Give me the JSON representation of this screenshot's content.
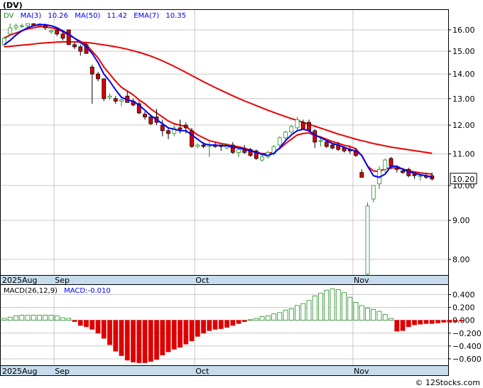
{
  "title": "(DV)",
  "watermark": "© 12Stocks.com",
  "last_price_label": "10.20",
  "legend": {
    "ticker": "DV",
    "ma3_label": "MA(3)",
    "ma3_value": "10.26",
    "ma50_label": "MA(50)",
    "ma50_value": "11.42",
    "ema7_label": "EMA(7)",
    "ema7_value": "10.35"
  },
  "macd_legend": {
    "params": "MACD(26,12,9)",
    "value": "MACD:-0.010"
  },
  "x_axis": {
    "labels": [
      "2025Aug",
      "Sep",
      "Oct",
      "Nov"
    ]
  },
  "colors": {
    "up_candle": "#228b22",
    "down_candle": "#dd0000",
    "ma3": "#0000ee",
    "ma50": "#ee0000",
    "ema7": "#ee0000",
    "axis_band": "#c6dcec",
    "grid": "#c8c8c8"
  },
  "chart_data": [
    {
      "type": "candlestick",
      "title": "",
      "y_ticks": [
        8.0,
        9.0,
        10.0,
        11.0,
        12.0,
        13.0,
        14.0,
        15.0,
        16.0
      ],
      "y_tick_labels": [
        "8.00",
        "9.00",
        "10.00",
        "11.00",
        "12.00",
        "13.00",
        "14.00",
        "15.00",
        "16.00"
      ],
      "log_scale": true,
      "grid": true,
      "ohlc": [
        [
          15.3,
          15.7,
          15.2,
          15.6
        ],
        [
          15.8,
          16.3,
          15.7,
          16.1
        ],
        [
          16.1,
          16.3,
          16.0,
          16.2
        ],
        [
          16.2,
          16.3,
          16.1,
          16.2
        ],
        [
          16.2,
          16.3,
          16.1,
          16.3
        ],
        [
          16.3,
          16.3,
          16.2,
          16.2
        ],
        [
          16.2,
          16.3,
          16.1,
          16.3
        ],
        [
          16.2,
          16.3,
          16.0,
          16.1
        ],
        [
          15.9,
          16.0,
          15.8,
          15.95
        ],
        [
          16.0,
          16.1,
          15.7,
          15.8
        ],
        [
          15.8,
          15.9,
          15.5,
          15.6
        ],
        [
          16.0,
          16.0,
          15.3,
          15.3
        ],
        [
          15.3,
          15.4,
          15.1,
          15.2
        ],
        [
          15.2,
          15.3,
          14.8,
          15.0
        ],
        [
          15.3,
          15.4,
          14.9,
          14.9
        ],
        [
          14.3,
          14.4,
          12.8,
          14.0
        ],
        [
          14.0,
          14.1,
          13.7,
          13.8
        ],
        [
          13.8,
          13.8,
          12.9,
          13.0
        ],
        [
          13.05,
          13.2,
          12.95,
          13.1
        ],
        [
          13.0,
          13.1,
          12.8,
          12.9
        ],
        [
          12.9,
          13.0,
          12.7,
          12.95
        ],
        [
          13.1,
          13.3,
          12.9,
          12.85
        ],
        [
          12.9,
          13.0,
          12.7,
          12.75
        ],
        [
          12.8,
          12.9,
          12.4,
          12.45
        ],
        [
          12.4,
          12.5,
          12.2,
          12.3
        ],
        [
          12.3,
          12.4,
          12.0,
          12.05
        ],
        [
          12.3,
          12.6,
          12.0,
          12.1
        ],
        [
          12.0,
          12.2,
          11.6,
          11.8
        ],
        [
          11.8,
          11.9,
          11.5,
          11.7
        ],
        [
          11.7,
          12.0,
          11.6,
          11.9
        ],
        [
          11.9,
          12.2,
          11.7,
          11.85
        ],
        [
          12.0,
          12.1,
          11.7,
          11.9
        ],
        [
          11.8,
          11.9,
          11.2,
          11.25
        ],
        [
          11.25,
          11.35,
          11.2,
          11.3
        ],
        [
          11.3,
          11.4,
          11.2,
          11.25
        ],
        [
          11.25,
          11.4,
          10.9,
          11.3
        ],
        [
          11.3,
          11.4,
          11.2,
          11.25
        ],
        [
          11.3,
          11.3,
          11.1,
          11.25
        ],
        [
          11.2,
          11.35,
          11.15,
          11.3
        ],
        [
          11.3,
          11.4,
          11.0,
          11.05
        ],
        [
          11.05,
          11.2,
          10.9,
          11.15
        ],
        [
          11.15,
          11.3,
          11.0,
          11.05
        ],
        [
          11.15,
          11.2,
          10.9,
          10.95
        ],
        [
          11.1,
          11.15,
          10.8,
          10.85
        ],
        [
          10.8,
          10.95,
          10.75,
          10.9
        ],
        [
          10.9,
          11.1,
          10.85,
          11.05
        ],
        [
          11.0,
          11.3,
          10.95,
          11.25
        ],
        [
          11.3,
          11.6,
          11.2,
          11.55
        ],
        [
          11.55,
          11.8,
          11.45,
          11.75
        ],
        [
          11.75,
          12.0,
          11.7,
          11.95
        ],
        [
          11.9,
          12.3,
          11.8,
          12.2
        ],
        [
          12.1,
          12.2,
          11.9,
          11.85
        ],
        [
          12.1,
          12.2,
          11.75,
          11.8
        ],
        [
          11.8,
          11.85,
          11.2,
          11.4
        ],
        [
          11.45,
          11.55,
          11.25,
          11.45
        ],
        [
          11.4,
          11.45,
          11.2,
          11.25
        ],
        [
          11.3,
          11.35,
          11.15,
          11.2
        ],
        [
          11.3,
          11.4,
          11.1,
          11.15
        ],
        [
          11.2,
          11.25,
          11.05,
          11.1
        ],
        [
          11.15,
          11.25,
          11.0,
          11.1
        ],
        [
          11.1,
          11.2,
          10.9,
          10.95
        ],
        [
          10.4,
          10.5,
          10.3,
          10.25
        ],
        [
          7.65,
          9.5,
          7.55,
          9.4
        ],
        [
          9.6,
          10.0,
          9.5,
          10.0
        ],
        [
          10.05,
          10.6,
          9.9,
          10.5
        ],
        [
          10.5,
          10.85,
          10.4,
          10.8
        ],
        [
          10.85,
          10.9,
          10.5,
          10.6
        ],
        [
          10.55,
          10.6,
          10.4,
          10.5
        ],
        [
          10.45,
          10.55,
          10.35,
          10.4
        ],
        [
          10.5,
          10.55,
          10.25,
          10.3
        ],
        [
          10.35,
          10.4,
          10.2,
          10.3
        ],
        [
          10.3,
          10.4,
          10.15,
          10.3
        ],
        [
          10.3,
          10.35,
          10.2,
          10.25
        ],
        [
          10.3,
          10.4,
          10.15,
          10.2
        ]
      ],
      "series": [
        {
          "name": "MA(3)",
          "values": [
            15.3,
            15.5,
            15.75,
            15.95,
            16.1,
            16.2,
            16.25,
            16.25,
            16.2,
            16.1,
            15.95,
            15.8,
            15.6,
            15.4,
            15.2,
            14.9,
            14.5,
            14.0,
            13.7,
            13.35,
            13.05,
            12.95,
            12.9,
            12.75,
            12.55,
            12.35,
            12.2,
            12.05,
            11.9,
            11.85,
            11.8,
            11.8,
            11.65,
            11.5,
            11.35,
            11.3,
            11.3,
            11.28,
            11.27,
            11.23,
            11.2,
            11.15,
            11.1,
            11.05,
            10.98,
            10.95,
            11.02,
            11.2,
            11.45,
            11.65,
            11.8,
            11.85,
            11.8,
            11.65,
            11.55,
            11.45,
            11.35,
            11.3,
            11.22,
            11.15,
            11.1,
            10.95,
            10.6,
            10.3,
            10.25,
            10.35,
            10.6,
            10.6,
            10.5,
            10.42,
            10.38,
            10.33,
            10.3,
            10.26
          ]
        },
        {
          "name": "MA(50)",
          "values": [
            15.2,
            15.22,
            15.25,
            15.28,
            15.3,
            15.33,
            15.36,
            15.38,
            15.4,
            15.42,
            15.43,
            15.43,
            15.43,
            15.42,
            15.4,
            15.37,
            15.33,
            15.29,
            15.25,
            15.2,
            15.15,
            15.09,
            15.02,
            14.95,
            14.87,
            14.78,
            14.68,
            14.57,
            14.45,
            14.33,
            14.2,
            14.07,
            13.94,
            13.81,
            13.68,
            13.56,
            13.44,
            13.33,
            13.22,
            13.11,
            13.01,
            12.91,
            12.82,
            12.73,
            12.64,
            12.55,
            12.47,
            12.39,
            12.31,
            12.24,
            12.17,
            12.1,
            12.03,
            11.96,
            11.89,
            11.82,
            11.75,
            11.68,
            11.62,
            11.56,
            11.5,
            11.45,
            11.4,
            11.35,
            11.31,
            11.27,
            11.23,
            11.2,
            11.17,
            11.14,
            11.11,
            11.08,
            11.05,
            11.02
          ]
        },
        {
          "name": "EMA(7)",
          "values": [
            15.6,
            15.75,
            15.85,
            15.95,
            16.05,
            16.1,
            16.15,
            16.15,
            16.1,
            16.05,
            15.9,
            15.75,
            15.6,
            15.45,
            15.3,
            15.0,
            14.7,
            14.3,
            14.0,
            13.7,
            13.45,
            13.3,
            13.15,
            12.95,
            12.8,
            12.6,
            12.45,
            12.3,
            12.15,
            12.05,
            12.0,
            11.95,
            11.8,
            11.65,
            11.55,
            11.45,
            11.4,
            11.35,
            11.32,
            11.27,
            11.24,
            11.19,
            11.13,
            11.06,
            11.01,
            11.01,
            11.06,
            11.18,
            11.35,
            11.5,
            11.65,
            11.7,
            11.72,
            11.63,
            11.58,
            11.5,
            11.42,
            11.36,
            11.29,
            11.25,
            11.17,
            10.95,
            10.6,
            10.45,
            10.43,
            10.52,
            10.55,
            10.54,
            10.51,
            10.46,
            10.42,
            10.39,
            10.37,
            10.35
          ]
        }
      ]
    },
    {
      "type": "bar",
      "title": "MACD(26,12,9)",
      "y_ticks": [
        0.4,
        0.2,
        0.0,
        -0.2,
        -0.4,
        -0.6
      ],
      "y_tick_labels": [
        "0.400",
        "0.200",
        "0.000",
        "−0.200",
        "−0.400",
        "−0.600"
      ],
      "ylim": [
        -0.7,
        0.55
      ],
      "values": [
        0.03,
        0.05,
        0.07,
        0.08,
        0.08,
        0.08,
        0.08,
        0.08,
        0.08,
        0.07,
        0.04,
        0.03,
        -0.02,
        -0.08,
        -0.1,
        -0.14,
        -0.2,
        -0.28,
        -0.38,
        -0.48,
        -0.55,
        -0.62,
        -0.65,
        -0.66,
        -0.66,
        -0.64,
        -0.61,
        -0.54,
        -0.49,
        -0.45,
        -0.42,
        -0.37,
        -0.32,
        -0.25,
        -0.2,
        -0.16,
        -0.14,
        -0.13,
        -0.11,
        -0.08,
        -0.05,
        -0.02,
        0.01,
        0.03,
        0.06,
        0.07,
        0.1,
        0.12,
        0.16,
        0.18,
        0.23,
        0.26,
        0.31,
        0.38,
        0.42,
        0.47,
        0.49,
        0.48,
        0.43,
        0.36,
        0.28,
        0.23,
        0.19,
        0.17,
        0.14,
        0.09,
        0.03,
        -0.17,
        -0.16,
        -0.1,
        -0.07,
        -0.06,
        -0.05,
        -0.05,
        -0.04,
        -0.03,
        -0.03,
        -0.02,
        -0.01
      ]
    }
  ]
}
